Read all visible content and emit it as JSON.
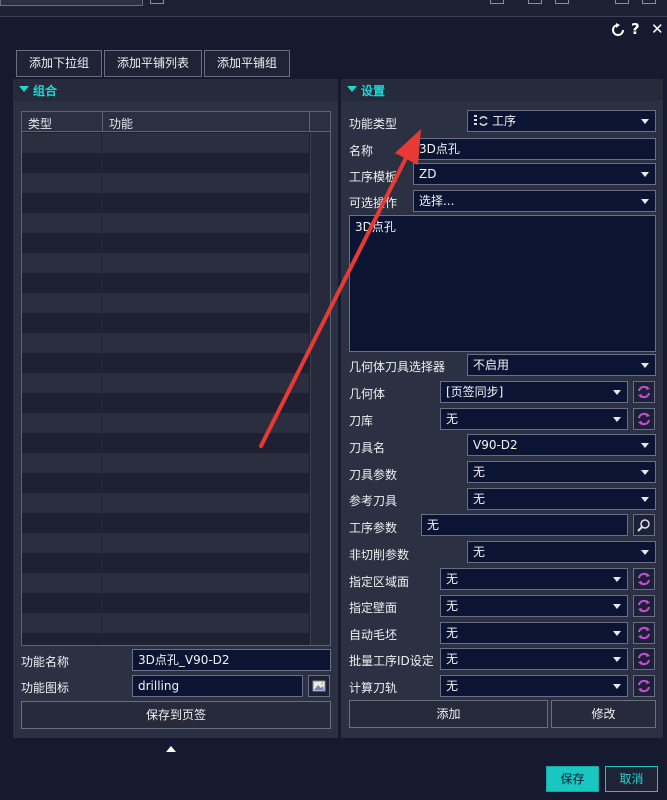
{
  "title_bar": {
    "help_icon": "?",
    "close_icon": "✕"
  },
  "toolbar": {
    "add_dropdown_group": "添加下拉组",
    "add_tile_list": "添加平铺列表",
    "add_tile_group": "添加平铺组"
  },
  "group_panel": {
    "title": "组合",
    "columns": [
      "类型",
      "功能"
    ],
    "function_name_label": "功能名称",
    "function_name_value": "3D点孔_V90-D2",
    "function_icon_label": "功能图标",
    "function_icon_value": "drilling",
    "save_to_tab": "保存到页签"
  },
  "settings_panel": {
    "title": "设置",
    "function_type_label": "功能类型",
    "function_type_value": "工序",
    "name_label": "名称",
    "name_value": "3D点孔",
    "template_label": "工序模板",
    "template_value": "ZD",
    "optional_op_label": "可选操作",
    "optional_op_value": "选择...",
    "description_text": "3D点孔",
    "geo_tool_selector_label": "几何体刀具选择器",
    "geo_tool_selector_value": "不启用",
    "geometry_label": "几何体",
    "geometry_value": "[页签同步]",
    "tool_library_label": "刀库",
    "tool_library_value": "无",
    "tool_name_label": "刀具名",
    "tool_name_value": "V90-D2",
    "tool_params_label": "刀具参数",
    "tool_params_value": "无",
    "ref_tool_label": "参考刀具",
    "ref_tool_value": "无",
    "op_params_label": "工序参数",
    "op_params_value": "无",
    "non_cut_label": "非切削参数",
    "non_cut_value": "无",
    "region_face_label": "指定区域面",
    "region_face_value": "无",
    "wall_face_label": "指定壁面",
    "wall_face_value": "无",
    "auto_blank_label": "自动毛坯",
    "auto_blank_value": "无",
    "batch_id_label": "批量工序ID设定",
    "batch_id_value": "无",
    "calc_path_label": "计算刀轨",
    "calc_path_value": "无",
    "add_button": "添加",
    "modify_button": "修改"
  },
  "footer": {
    "save": "保存",
    "cancel": "取消"
  },
  "colors": {
    "accent": "#1fd6d0",
    "annotation_arrow": "#e83a35",
    "field_bg": "#0b1433"
  }
}
